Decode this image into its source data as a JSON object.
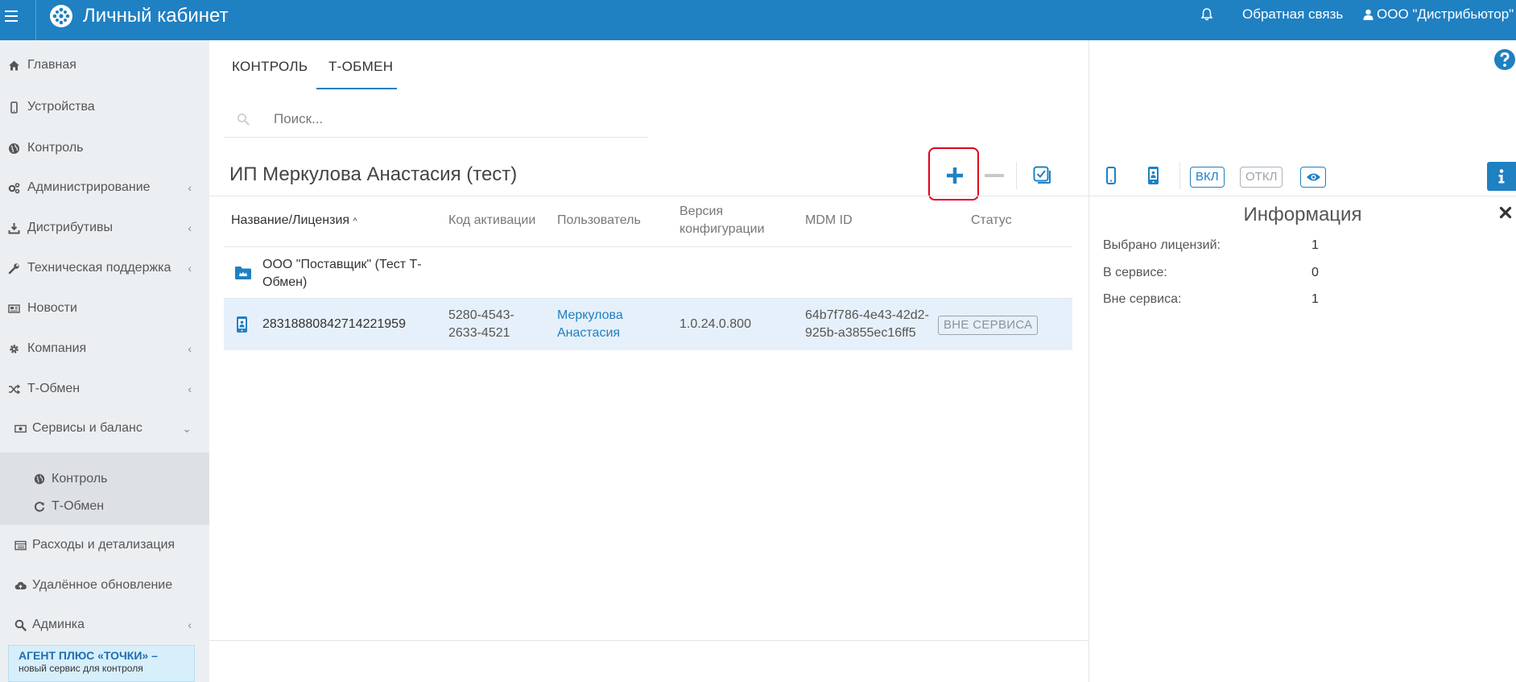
{
  "header": {
    "app_title": "Личный кабинет",
    "feedback": "Обратная связь",
    "user_name": "ООО \"Дистрибьютор\""
  },
  "sidebar": {
    "items": [
      {
        "label": "Главная",
        "icon": "home-icon"
      },
      {
        "label": "Устройства",
        "icon": "mobile-icon"
      },
      {
        "label": "Контроль",
        "icon": "globe-icon"
      },
      {
        "label": "Администрирование",
        "icon": "cogs-icon"
      },
      {
        "label": "Дистрибутивы",
        "icon": "download-icon"
      },
      {
        "label": "Техническая поддержка",
        "icon": "wrench-icon"
      },
      {
        "label": "Новости",
        "icon": "newspaper-icon"
      },
      {
        "label": "Компания",
        "icon": "gear-icon"
      },
      {
        "label": "Т-Обмен",
        "icon": "shuffle-icon"
      },
      {
        "label": "Сервисы и баланс",
        "icon": "money-icon"
      },
      {
        "label": "Расходы и детализация",
        "icon": "list-icon"
      },
      {
        "label": "Удалённое обновление",
        "icon": "cloud-upload-icon"
      },
      {
        "label": "Админка",
        "icon": "search-icon"
      }
    ],
    "subitems": [
      {
        "label": "Контроль",
        "icon": "globe-icon"
      },
      {
        "label": "Т-Обмен",
        "icon": "refresh-icon"
      }
    ],
    "banner": {
      "line1": "АГЕНТ ПЛЮС «ТОЧКИ» –",
      "line2": "новый сервис для контроля"
    }
  },
  "main": {
    "tabs": [
      {
        "label": "КОНТРОЛЬ"
      },
      {
        "label": "Т-ОБМЕН",
        "active": true
      }
    ],
    "search": {
      "placeholder": "Поиск..."
    },
    "title": "ИП Меркулова Анастасия (тест)",
    "table": {
      "columns": [
        "Название/Лицензия",
        "Код активации",
        "Пользователь",
        "Версия конфигурации",
        "MDM ID",
        "Статус"
      ],
      "folder_row": {
        "name": "ООО \"Поставщик\" (Тест Т-Обмен)"
      },
      "license_row": {
        "license": "28318880842714221959",
        "activation_code": "5280-4543-2633-4521",
        "user": "Меркулова Анастасия",
        "version": "1.0.24.0.800",
        "mdm_id": "64b7f786-4e43-42d2-925b-a3855ec16ff5",
        "status": "ВНЕ СЕРВИСА"
      }
    }
  },
  "right_panel": {
    "on_label": "ВКЛ",
    "off_label": "ОТКЛ",
    "info_title": "Информация",
    "rows": [
      {
        "label": "Выбрано лицензий:",
        "value": "1"
      },
      {
        "label": "В сервисе:",
        "value": "0"
      },
      {
        "label": "Вне сервиса:",
        "value": "1"
      }
    ]
  },
  "colors": {
    "brand": "#1f80c2",
    "highlight": "#e3001b",
    "row_selected": "#e6f0fa",
    "sidebar": "#eceff2"
  }
}
